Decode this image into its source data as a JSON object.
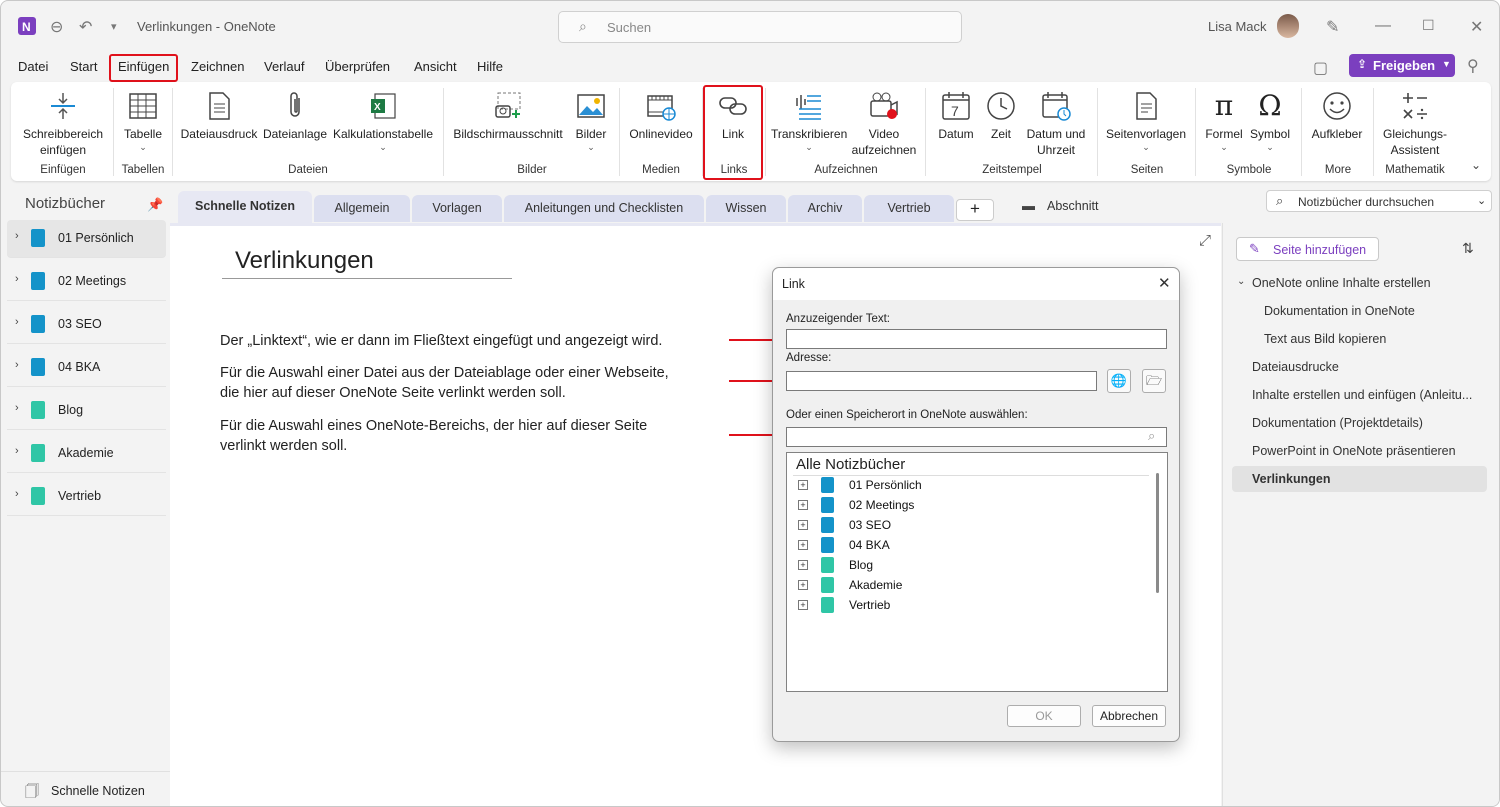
{
  "window": {
    "title": "Verlinkungen  -  OneNote",
    "search_placeholder": "Suchen",
    "user": "Lisa Mack"
  },
  "menu": {
    "items": [
      "Datei",
      "Start",
      "Einfügen",
      "Zeichnen",
      "Verlauf",
      "Überprüfen",
      "Ansicht",
      "Hilfe"
    ],
    "active": "Einfügen",
    "share_label": "Freigeben"
  },
  "ribbon": {
    "buttons": {
      "schreibbereich": "Schreibbereich\neinfügen",
      "tabelle": "Tabelle",
      "dateiausdruck": "Dateiausdruck",
      "dateianlage": "Dateianlage",
      "kalkulationstabelle": "Kalkulationstabelle",
      "bildschirmausschnitt": "Bildschirmausschnitt",
      "bilder": "Bilder",
      "onlinevideo": "Onlinevideo",
      "link": "Link",
      "transkribieren": "Transkribieren",
      "video": "Video\naufzeichnen",
      "datum": "Datum",
      "zeit": "Zeit",
      "datum_uhrzeit": "Datum und\nUhrzeit",
      "seitenvorlagen": "Seitenvorlagen",
      "formel": "Formel",
      "symbol": "Symbol",
      "aufkleber": "Aufkleber",
      "gleichungs": "Gleichungs-\nAssistent"
    },
    "groups": {
      "einfuegen": "Einfügen",
      "tabellen": "Tabellen",
      "dateien": "Dateien",
      "bilder": "Bilder",
      "medien": "Medien",
      "links": "Links",
      "aufzeichnen": "Aufzeichnen",
      "zeitstempel": "Zeitstempel",
      "seiten": "Seiten",
      "symbole": "Symbole",
      "more": "More",
      "mathematik": "Mathematik"
    },
    "date_icon_day": "7"
  },
  "notebooks": {
    "header": "Notizbücher",
    "items": [
      {
        "label": "01 Persönlich",
        "color": "#1493c9"
      },
      {
        "label": "02 Meetings",
        "color": "#1493c9"
      },
      {
        "label": "03 SEO",
        "color": "#1493c9"
      },
      {
        "label": "04 BKA",
        "color": "#1493c9"
      },
      {
        "label": "Blog",
        "color": "#2fc6a6"
      },
      {
        "label": "Akademie",
        "color": "#2fc6a6"
      },
      {
        "label": "Vertrieb",
        "color": "#2fc6a6"
      }
    ],
    "quick_notes": "Schnelle Notizen"
  },
  "section_tabs": [
    "Schnelle Notizen",
    "Allgemein",
    "Vorlagen",
    "Anleitungen und Checklisten",
    "Wissen",
    "Archiv",
    "Vertrieb"
  ],
  "section_tab_add": "+",
  "abschnitt_label": "Abschnitt",
  "notebook_search_placeholder": "Notizbücher durchsuchen",
  "page": {
    "title": "Verlinkungen",
    "notes": [
      "Der „Linktext“, wie er dann im Fließtext eingefügt und angezeigt wird.",
      "Für die Auswahl einer Datei aus der Dateiablage oder einer Webseite,\ndie hier auf dieser OneNote Seite verlinkt werden soll.",
      "Für die Auswahl eines OneNote-Bereichs, der hier auf dieser Seite\nverlinkt werden soll."
    ]
  },
  "pages_panel": {
    "add_page": "Seite hinzufügen",
    "items": [
      "OneNote online Inhalte erstellen",
      "Dokumentation in OneNote",
      "Text aus Bild kopieren",
      "Dateiausdrucke",
      "Inhalte erstellen und einfügen (Anleitu...",
      "Dokumentation (Projektdetails)",
      "PowerPoint in OneNote präsentieren",
      "Verlinkungen"
    ]
  },
  "dialog": {
    "title": "Link",
    "text_label": "Anzuzeigender Text:",
    "text_value": "",
    "address_label": "Adresse:",
    "address_value": "",
    "location_label": "Oder einen Speicherort in OneNote auswählen:",
    "location_value": "",
    "tree_header": "Alle Notizbücher",
    "tree_items": [
      "01 Persönlich",
      "02 Meetings",
      "03 SEO",
      "04 BKA",
      "Blog",
      "Akademie",
      "Vertrieb"
    ],
    "ok": "OK",
    "cancel": "Abbrechen"
  },
  "colors": {
    "accent": "#7b3fbf",
    "highlight_red": "#e0111b",
    "notebook_blue": "#1493c9",
    "notebook_teal": "#2fc6a6"
  }
}
